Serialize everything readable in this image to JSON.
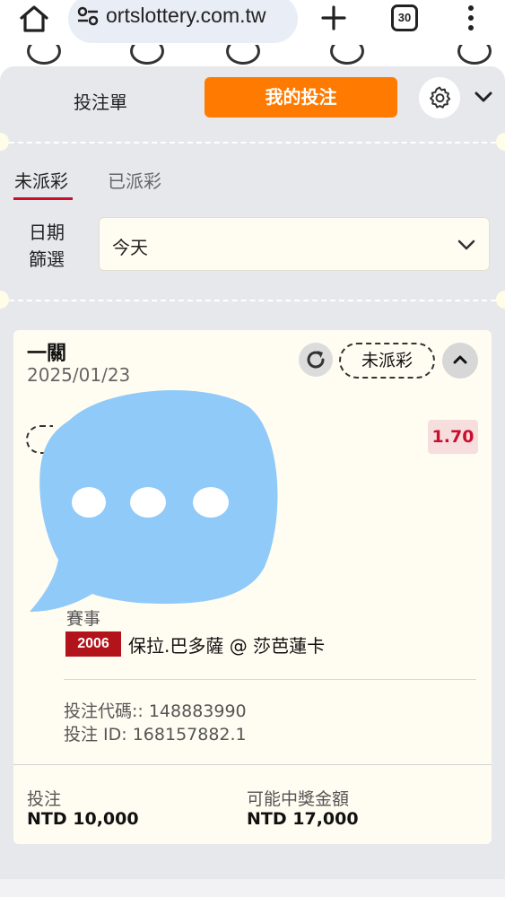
{
  "browser": {
    "url": "ortslottery.com.tw",
    "tab_count": "30"
  },
  "header": {
    "bet_slip_label": "投注單",
    "my_bets_label": "我的投注"
  },
  "tabs": {
    "unpaid": "未派彩",
    "paid": "已派彩"
  },
  "filter": {
    "label": "日期\n篩選",
    "label_line1": "日期",
    "label_line2": "篩選",
    "value": "今天"
  },
  "bet": {
    "type": "一關",
    "date": "2025/01/23",
    "status": "未派彩",
    "odds": "1.70",
    "event_label": "賽事",
    "event_code": "2006",
    "event_name": "保拉.巴多薩 @ 莎芭蓮卡",
    "bet_code": "投注代碼:: 148883990",
    "bet_id": "投注 ID: 168157882.1",
    "stake_label": "投注",
    "stake_value": "NTD 10,000",
    "payout_label": "可能中獎金額",
    "payout_value": "NTD 17,000"
  },
  "colors": {
    "accent_orange": "#ff7a00",
    "brand_red": "#c8102e",
    "card_bg": "#fffdf2",
    "panel_bg": "#e7e8ec",
    "redaction_blue": "#90caf9"
  }
}
